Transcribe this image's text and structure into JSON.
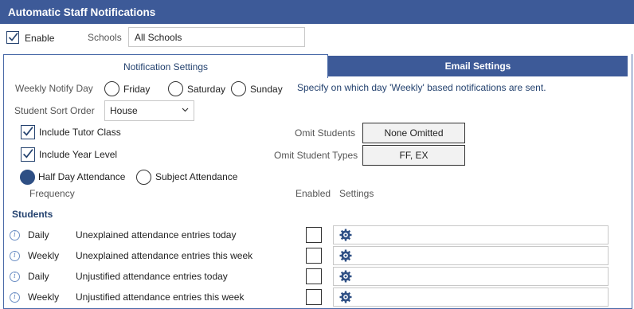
{
  "header": {
    "title": "Automatic Staff Notifications"
  },
  "enable": {
    "label": "Enable",
    "checked": true
  },
  "schools": {
    "label": "Schools",
    "value": "All Schools"
  },
  "tabs": [
    {
      "label": "Notification Settings",
      "active": true
    },
    {
      "label": "Email Settings",
      "active": false
    }
  ],
  "weekly_notify": {
    "label": "Weekly Notify Day",
    "options": [
      "Friday",
      "Saturday",
      "Sunday"
    ],
    "selected": null,
    "note": "Specify on which day 'Weekly' based notifications are sent."
  },
  "sort_order": {
    "label": "Student Sort Order",
    "value": "House"
  },
  "include_tutor": {
    "label": "Include Tutor Class",
    "checked": true
  },
  "include_year": {
    "label": "Include Year Level",
    "checked": true
  },
  "omit_students": {
    "label": "Omit Students",
    "value": "None Omitted"
  },
  "omit_types": {
    "label": "Omit Student Types",
    "value": "FF, EX"
  },
  "attendance_mode": {
    "options": [
      "Half Day Attendance",
      "Subject Attendance"
    ],
    "selected": "Half Day Attendance"
  },
  "columns": {
    "frequency": "Frequency",
    "enabled": "Enabled",
    "settings": "Settings"
  },
  "section": {
    "title": "Students"
  },
  "rows": [
    {
      "frequency": "Daily",
      "description": "Unexplained attendance entries today",
      "enabled": false
    },
    {
      "frequency": "Weekly",
      "description": "Unexplained attendance entries this week",
      "enabled": false
    },
    {
      "frequency": "Daily",
      "description": "Unjustified attendance entries today",
      "enabled": false
    },
    {
      "frequency": "Weekly",
      "description": "Unjustified attendance entries this week",
      "enabled": false
    }
  ],
  "colors": {
    "header_bg": "#3d5a98",
    "accent": "#24426f",
    "info": "#6d8fc4"
  },
  "icons": {
    "settings": "gear-icon",
    "info": "info-icon",
    "dropdown": "chevron-down-icon"
  }
}
